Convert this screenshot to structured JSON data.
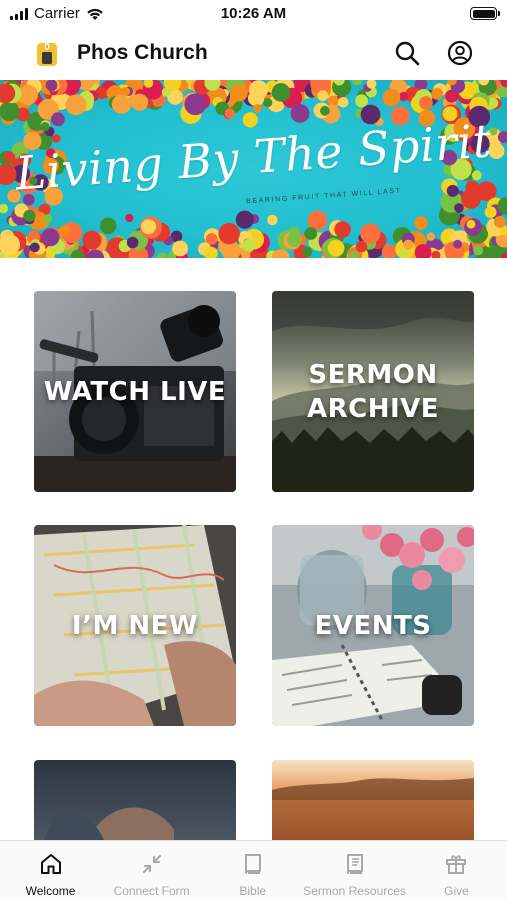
{
  "status_bar": {
    "carrier": "Carrier",
    "time": "10:26 AM"
  },
  "header": {
    "title": "Phos Church",
    "logo_icon": "candle-logo-icon",
    "search_icon": "search-icon",
    "profile_icon": "profile-icon"
  },
  "banner": {
    "title": "Living By The Spirit",
    "subtitle": "BEARING FRUIT THAT WILL LAST"
  },
  "tiles": [
    {
      "label": "WATCH LIVE"
    },
    {
      "label": "SERMON\nARCHIVE"
    },
    {
      "label": "I’M NEW"
    },
    {
      "label": "EVENTS"
    },
    {
      "label": ""
    },
    {
      "label": ""
    }
  ],
  "tab_bar": {
    "active": "Welcome",
    "items": [
      {
        "label": "Welcome",
        "icon": "home-icon"
      },
      {
        "label": "Connect Form",
        "icon": "compress-arrows-icon"
      },
      {
        "label": "Bible",
        "icon": "book-icon"
      },
      {
        "label": "Sermon Resources",
        "icon": "book-open-text-icon"
      },
      {
        "label": "Give",
        "icon": "gift-icon"
      }
    ]
  },
  "colors": {
    "banner_background": "#22bfd0",
    "active_tab": "#111111",
    "inactive_tab": "#a8a8a8",
    "logo_accent": "#f2c230"
  }
}
